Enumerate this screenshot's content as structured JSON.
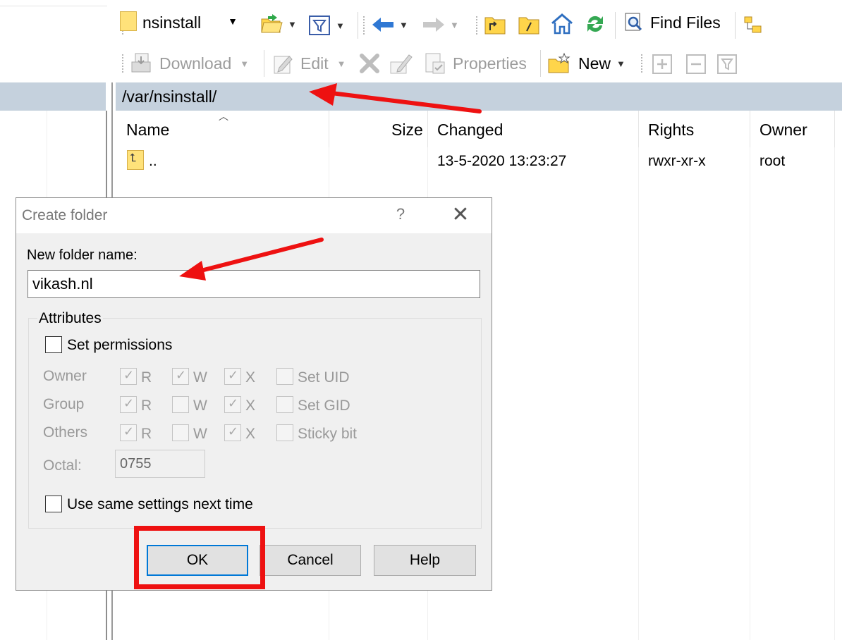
{
  "toolbar1": {
    "path_combo_value": "nsinstall",
    "find_files_label": "Find Files"
  },
  "toolbar2": {
    "download_label": "Download",
    "edit_label": "Edit",
    "properties_label": "Properties",
    "new_label": "New"
  },
  "address_bar": {
    "path": "/var/nsinstall/"
  },
  "file_list": {
    "columns": [
      "Name",
      "Size",
      "Changed",
      "Rights",
      "Owner"
    ],
    "rows": [
      {
        "name": "..",
        "size": "",
        "changed": "13-5-2020 13:23:27",
        "rights": "rwxr-xr-x",
        "owner": "root"
      }
    ]
  },
  "dialog": {
    "title": "Create folder",
    "help_glyph": "?",
    "close_glyph": "✕",
    "folder_name_label": "New folder name:",
    "folder_name_value": "vikash.nl",
    "attributes_label": "Attributes",
    "set_permissions_label": "Set permissions",
    "set_permissions_checked": false,
    "rows": [
      {
        "label": "Owner",
        "r": true,
        "w": true,
        "x": true,
        "special_label": "Set UID",
        "special": false
      },
      {
        "label": "Group",
        "r": true,
        "w": false,
        "x": true,
        "special_label": "Set GID",
        "special": false
      },
      {
        "label": "Others",
        "r": true,
        "w": false,
        "x": true,
        "special_label": "Sticky bit",
        "special": false
      }
    ],
    "perm_letters": {
      "r": "R",
      "w": "W",
      "x": "X"
    },
    "octal_label": "Octal:",
    "octal_value": "0755",
    "same_settings_label": "Use same settings next time",
    "same_settings_checked": false,
    "buttons": {
      "ok": "OK",
      "cancel": "Cancel",
      "help": "Help"
    }
  },
  "icons": {
    "folder": "folder-icon",
    "open_folder": "open-folder-icon",
    "filter": "filter-icon",
    "back": "back-arrow-icon",
    "forward": "forward-arrow-icon",
    "parent": "parent-directory-icon",
    "root": "root-directory-icon",
    "home": "home-icon",
    "refresh": "refresh-icon",
    "find": "find-files-icon",
    "tree": "tree-view-icon",
    "download": "download-icon",
    "edit": "edit-icon",
    "delete": "delete-icon",
    "rename": "rename-icon",
    "properties": "properties-icon",
    "new": "new-icon",
    "select": "select-icon",
    "unselect": "unselect-icon",
    "filter_select": "filter-select-icon"
  },
  "colors": {
    "header_band": "#c5d1dd",
    "annotation_red": "#ee1111",
    "ok_focus_border": "#0078d7"
  }
}
